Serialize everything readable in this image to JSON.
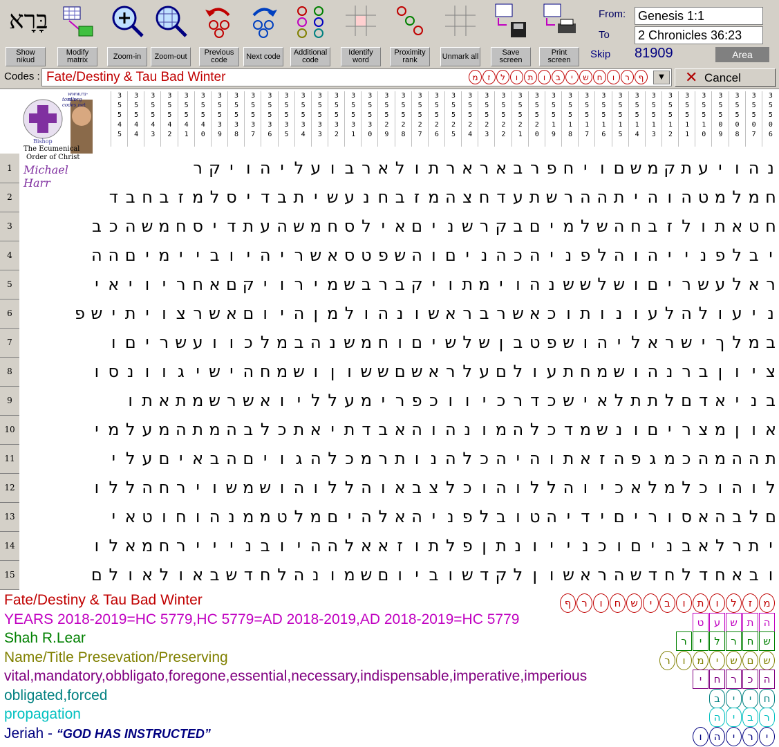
{
  "toolbar": {
    "buttons": [
      {
        "id": "show-nikud",
        "label": "Show nikud",
        "glyph": "בָּרָא"
      },
      {
        "id": "modify-matrix",
        "label": "Modify matrix"
      },
      {
        "id": "zoom-in",
        "label": "Zoom-in"
      },
      {
        "id": "zoom-out",
        "label": "Zoom-out"
      },
      {
        "id": "previous-code",
        "label": "Previous code"
      },
      {
        "id": "next-code",
        "label": "Next code"
      },
      {
        "id": "additional-code",
        "label": "Additional code"
      },
      {
        "id": "identify-word",
        "label": "Identify word"
      },
      {
        "id": "proximity-rank",
        "label": "Proximity rank"
      },
      {
        "id": "unmark-all",
        "label": "Unmark all"
      },
      {
        "id": "save-screen",
        "label": "Save screen"
      },
      {
        "id": "print-screen",
        "label": "Print screen"
      }
    ],
    "from_label": "From:",
    "from_value": "Genesis 1:1",
    "to_label": "To",
    "to_value": "2 Chronicles 36:23",
    "skip_label": "Skip",
    "skip_value": "81909",
    "area_label": "Area"
  },
  "codes": {
    "label": "Codes :",
    "value": "Fate/Destiny & Tau Bad Winter",
    "hebrew": [
      "מ",
      "ז",
      "ל",
      "ו",
      "ת",
      "ו",
      "ב",
      "י",
      "ש",
      "ח",
      "ו",
      "ר",
      "ף"
    ],
    "cancel_label": "Cancel"
  },
  "logo": {
    "url_line1": "www.ra-el.org",
    "url_line2": "torah-codes.net",
    "bishop": "Bishop",
    "order1": "The Ecumenical",
    "order2": "Order of Christ",
    "signature": "Michael Harr"
  },
  "skips": [
    "35545",
    "35544",
    "35543",
    "35542",
    "35541",
    "35540",
    "35539",
    "35538",
    "35537",
    "35536",
    "35535",
    "35534",
    "35533",
    "35532",
    "35531",
    "35530",
    "35529",
    "35528",
    "35527",
    "35526",
    "35525",
    "35524",
    "35523",
    "35522",
    "35521",
    "35520",
    "35519",
    "35518",
    "35517",
    "35516",
    "35515",
    "35514",
    "35513",
    "35512",
    "35511",
    "35510",
    "35509",
    "35508",
    "35507",
    "35506",
    "35505",
    "35504",
    "35503",
    "35502",
    "35501",
    "35500",
    "35499",
    "35498",
    "35497",
    "35496"
  ],
  "rows": [
    {
      "num": "1",
      "letters": "נהויעתקמשםוי׳חפרבארא׳רתולאר׳בועלי׳הויקר"
    },
    {
      "num": "2",
      "letters": "חמלמטהוהיתהה׳רשתעדחצ׳המזבחנעשיתבדיסלמזבחבד"
    },
    {
      "num": "3",
      "letters": "חטאתולזבחהשלמיםבקרשניםאיל׳סחמשהעתדי׳סחמשהכב"
    },
    {
      "num": "4",
      "letters": "יבלפנייהוהלפניהכהניםוהשפט׳סאשריהיוביימיםהה"
    },
    {
      "num": "5",
      "letters": "ראלעשריםושלששנהוימתויקברבשמירויקםאחריויאי"
    },
    {
      "num": "6",
      "letters": "ניעולהלעונותוכאשרבראשונהולמןהיוםאשרצויתיש׳פ"
    },
    {
      "num": "7",
      "letters": "במלךישראליהושפטבןשלשיםוחמשנהבמלכוועשריםו"
    },
    {
      "num": "8",
      "letters": "ציוןברנהושמחתעולםעלראשםששוןושמחהישיגוונסו"
    },
    {
      "num": "9",
      "letters": "בניאדםלתתלאישכדרכיווכפרימעלליואשרשמתאתו"
    },
    {
      "num": "10",
      "letters": "אוןמצריםונשמדכלהמונהוהאבדתיאתכלבהמתהמעלמי"
    },
    {
      "num": "11",
      "letters": "תההמהכמגפהזאתוהיהכלהנותרמכלהגויםהבאיםעלי"
    },
    {
      "num": "12",
      "letters": "לוהוכלמלאכיוהללוהוכלצבאוהללוהושמשוירחהללו"
    },
    {
      "num": "13",
      "letters": "םלבהאסוריםידיהטובלפניהאלהיםמלטממנהוחוטאי"
    },
    {
      "num": "14",
      "letters": "יתרלאבניםוכנייונתןפלתוזאאלההיובנייירחמאלו"
    },
    {
      "num": "15",
      "letters": "ובאחדלחדשהראשוןלקדשוביוםשמונהלחדשבאולאולם"
    }
  ],
  "legend": [
    {
      "text": "Fate/Destiny & Tau Bad Winter",
      "color": "#c00000",
      "marks": [
        "מ",
        "ז",
        "ל",
        "ו",
        "ת",
        "ו",
        "ב",
        "י",
        "ש",
        "ח",
        "ו",
        "ר",
        "ף"
      ],
      "shape": "ring"
    },
    {
      "text": "YEARS 2018-2019=HC 5779,HC 5779=AD 2018-2019,AD 2018-2019=HC 5779",
      "color": "#c000c0",
      "marks": [
        "ה",
        "ת",
        "ש",
        "ע",
        "ט"
      ],
      "shape": "box"
    },
    {
      "text": "Shah R.Lear",
      "color": "#008000",
      "marks": [
        "ש",
        "ח",
        "ר",
        "ל",
        "י",
        "ר"
      ],
      "shape": "box"
    },
    {
      "text": "Name/Title Presevation/Preserving",
      "color": "#808000",
      "marks": [
        "ש",
        "ם",
        "ש",
        "י",
        "מ",
        "ו",
        "ר"
      ],
      "shape": "ring"
    },
    {
      "text": "vital,mandatory,obbligato,foregone,essential,necessary,indispensable,imperative,imperious",
      "color": "#800080",
      "marks": [
        "ה",
        "כ",
        "ר",
        "ח",
        "י"
      ],
      "shape": "box"
    },
    {
      "text": "obligated,forced",
      "color": "#008080",
      "marks": [
        "ח",
        "י",
        "י",
        "ב"
      ],
      "shape": "diamond"
    },
    {
      "text": "propagation",
      "color": "#00c0c0",
      "marks": [
        "ר",
        "ב",
        "י",
        "ה"
      ],
      "shape": "diamond"
    },
    {
      "text": "Jeriah - ",
      "quote": "“GOD HAS INSTRUCTED”",
      "color": "#000080",
      "marks": [
        "י",
        "ר",
        "י",
        "ה",
        "ו"
      ],
      "shape": "ring"
    }
  ]
}
